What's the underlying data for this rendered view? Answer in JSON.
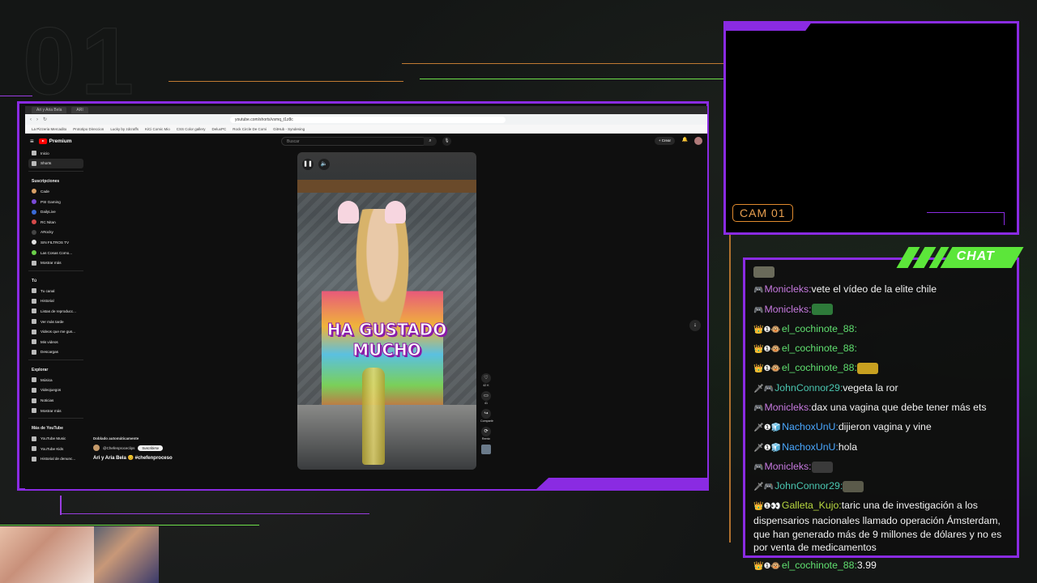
{
  "overlay": {
    "deco_number": "01",
    "cam_label": "CAM 01",
    "chat_title": "CHAT"
  },
  "browser": {
    "tabs": [
      "Ari y Aria Bela",
      "ARI"
    ],
    "url": "youtube.com/shorts/vsmq_t1z8c",
    "bookmarks": [
      "La Pizzeria Mercadito",
      "Prototipo Direccion",
      "Lucky by zdcraffs",
      "KiCi Comic Mio",
      "CSS Color gallery",
      "DeluxPC",
      "Rock Circle De Comi",
      "GitHub - Syndesing"
    ]
  },
  "youtube": {
    "logo": "Premium",
    "search_placeholder": "Buscar",
    "create_label": "Crear",
    "notif_count": "9+",
    "sidebar": {
      "main": [
        {
          "label": "Inicio",
          "icon": "home-icon"
        },
        {
          "label": "Shorts",
          "icon": "shorts-icon"
        }
      ],
      "subs_header": "Suscripciones",
      "subs": [
        {
          "label": "Cade",
          "color": "#d9a066"
        },
        {
          "label": "PSI Gaming",
          "color": "#7a4ad6"
        },
        {
          "label": "DailyLive",
          "color": "#3a6ad6"
        },
        {
          "label": "RC Nitan",
          "color": "#d64a4a"
        },
        {
          "label": "ARocky",
          "color": "#444444"
        },
        {
          "label": "SIN FILTROS TV",
          "color": "#e0e0e0"
        },
        {
          "label": "Las Cosas Como...",
          "color": "#6ad04a"
        },
        {
          "label": "Mostrar más",
          "color": ""
        }
      ],
      "you_header": "Tú",
      "you": [
        "Tu canal",
        "Historial",
        "Listas de reproducc...",
        "Ver más tarde",
        "Videos que me gus...",
        "Mis videos",
        "Descargas"
      ],
      "explore_header": "Explorar",
      "explore": [
        "Música",
        "Videojuegos",
        "Noticias",
        "Mostrar más"
      ],
      "more_header": "Más de YouTube",
      "more": [
        "YouTube Music",
        "YouTube Kids",
        "Historial de denunc..."
      ]
    },
    "video": {
      "caption_line1": "HA GUSTADO",
      "caption_line2": "MUCHO",
      "dubbed": "Doblado automáticamente",
      "channel": "@Chefenproceclips",
      "subscribe": "Suscribirse",
      "title": "Ari y Aria Bela 😊 #chefenproceso",
      "likes": "42 K",
      "comments": "41",
      "share": "Compartir",
      "remix": "Remix"
    }
  },
  "chat": {
    "messages": [
      {
        "badges": "",
        "user": "",
        "user_color": "u-pink",
        "text": "",
        "emote": "#6a6a5a"
      },
      {
        "badges": "🎮",
        "user": "Monicleks",
        "user_color": "u-pink",
        "text": "vete el vídeo de la elite chile",
        "emote": ""
      },
      {
        "badges": "🎮",
        "user": "Monicleks",
        "user_color": "u-pink",
        "text": "",
        "emote": "#2e7a3a"
      },
      {
        "badges": "👑❶🐵",
        "user": "el_cochinote_88",
        "user_color": "u-green",
        "text": "",
        "emote": ""
      },
      {
        "badges": "👑❶🐵",
        "user": "el_cochinote_88",
        "user_color": "u-green",
        "text": "",
        "emote": ""
      },
      {
        "badges": "👑❶🐵",
        "user": "el_cochinote_88",
        "user_color": "u-green",
        "text": "",
        "emote": "#c8a020"
      },
      {
        "badges": "🗡🎮",
        "user": "JohnConnor29",
        "user_color": "u-teal",
        "text": "vegeta la ror",
        "emote": ""
      },
      {
        "badges": "🎮",
        "user": "Monicleks",
        "user_color": "u-pink",
        "text": "dax una vagina que debe tener más ets",
        "emote": ""
      },
      {
        "badges": "🗡❶🧊",
        "user": "NachoxUnU",
        "user_color": "u-blue",
        "text": "dijieron vagina y vine",
        "emote": ""
      },
      {
        "badges": "🗡❶🧊",
        "user": "NachoxUnU",
        "user_color": "u-blue",
        "text": "hola",
        "emote": ""
      },
      {
        "badges": "🎮",
        "user": "Monicleks",
        "user_color": "u-pink",
        "text": "",
        "emote": "#3a3a3a"
      },
      {
        "badges": "🗡🎮",
        "user": "JohnConnor29",
        "user_color": "u-teal",
        "text": "",
        "emote": "#5a5a4a"
      },
      {
        "badges": "👑❶👀",
        "user": "Galleta_Kujo",
        "user_color": "u-olive",
        "text": "taric una de investigación a los dispensarios nacionales llamado operación Ámsterdam, que han generado más de 9 millones de dólares y no es por venta de medicamentos",
        "emote": ""
      },
      {
        "badges": "👑❶🐵",
        "user": "el_cochinote_88",
        "user_color": "u-green",
        "text": "3.99",
        "emote": ""
      }
    ]
  }
}
